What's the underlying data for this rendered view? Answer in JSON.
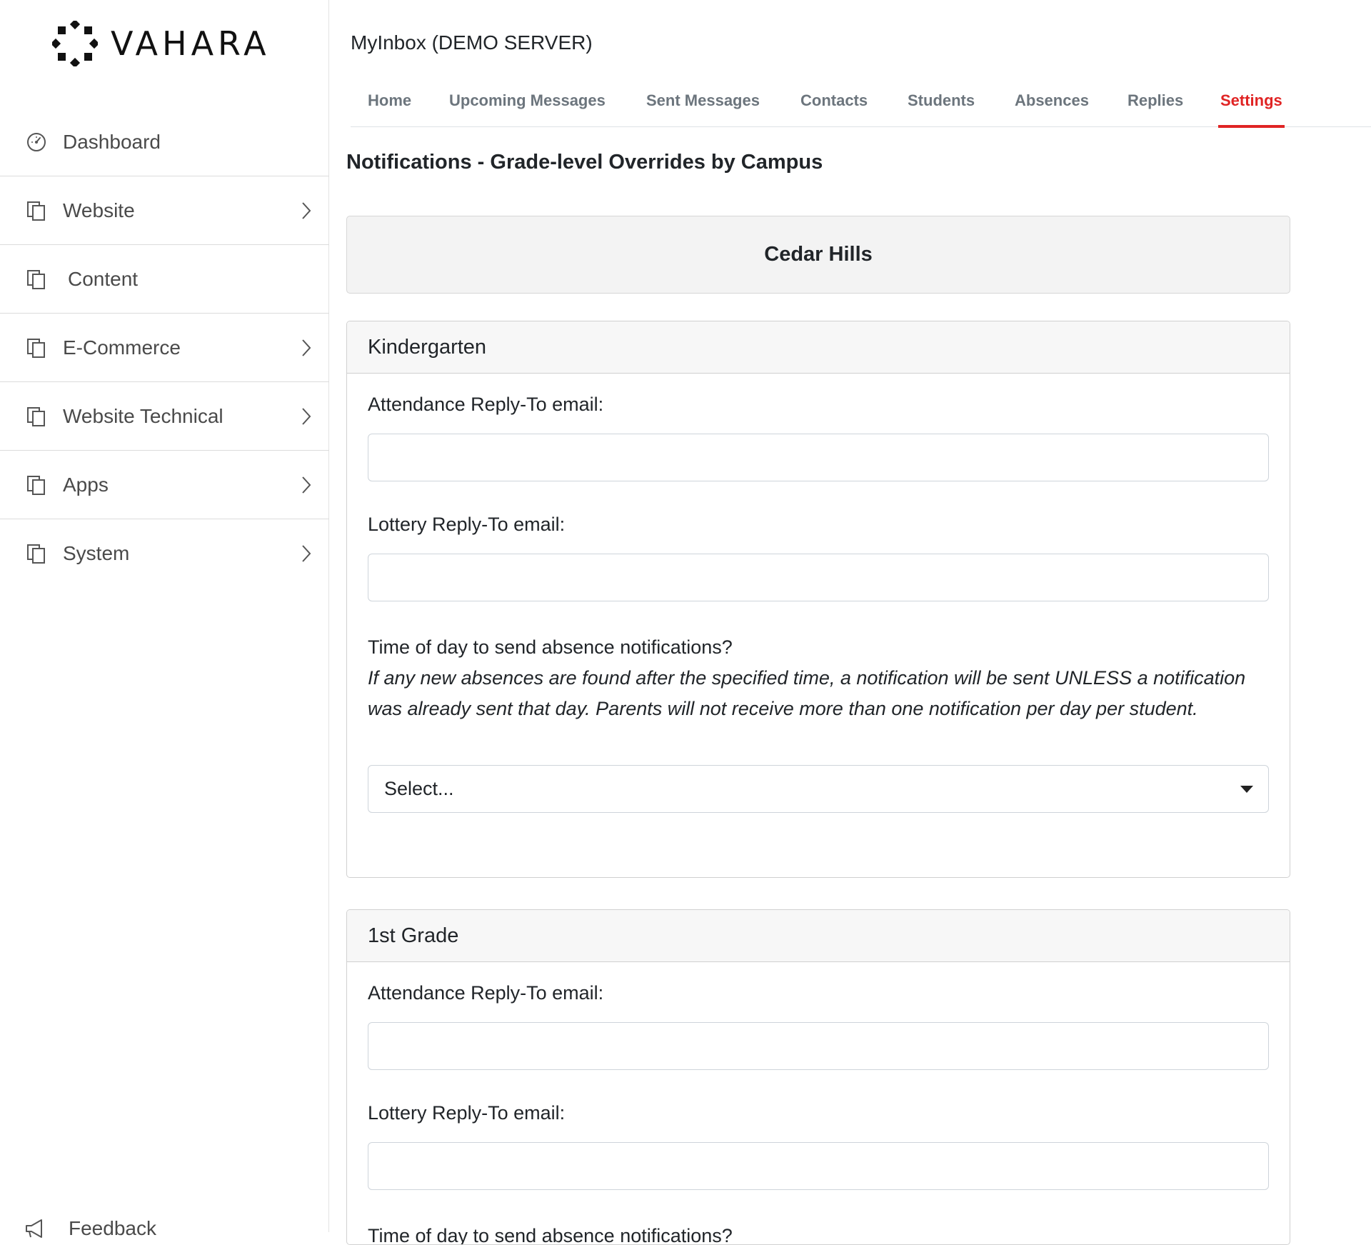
{
  "brand": {
    "name": "VAHARA"
  },
  "sidebar": {
    "items": [
      {
        "label": "Dashboard",
        "icon": "dashboard-gauge-icon",
        "has_chevron": false
      },
      {
        "label": "Website",
        "icon": "copy-pages-icon",
        "has_chevron": true
      },
      {
        "label": "Content",
        "icon": "copy-pages-icon",
        "has_chevron": false
      },
      {
        "label": "E-Commerce",
        "icon": "copy-pages-icon",
        "has_chevron": true
      },
      {
        "label": "Website Technical",
        "icon": "copy-pages-icon",
        "has_chevron": true
      },
      {
        "label": "Apps",
        "icon": "copy-pages-icon",
        "has_chevron": true
      },
      {
        "label": "System",
        "icon": "copy-pages-icon",
        "has_chevron": true
      }
    ],
    "feedback_label": "Feedback"
  },
  "app": {
    "title": "MyInbox (DEMO SERVER)"
  },
  "tabs": [
    {
      "label": "Home",
      "active": false
    },
    {
      "label": "Upcoming Messages",
      "active": false
    },
    {
      "label": "Sent Messages",
      "active": false
    },
    {
      "label": "Contacts",
      "active": false
    },
    {
      "label": "Students",
      "active": false
    },
    {
      "label": "Absences",
      "active": false
    },
    {
      "label": "Replies",
      "active": false
    },
    {
      "label": "Settings",
      "active": true
    }
  ],
  "page": {
    "title": "Notifications - Grade-level Overrides by Campus"
  },
  "campus": {
    "name": "Cedar Hills"
  },
  "grades": [
    {
      "name": "Kindergarten",
      "attendance_label": "Attendance Reply-To email:",
      "attendance_value": "",
      "lottery_label": "Lottery Reply-To email:",
      "lottery_value": "",
      "time_label": "Time of day to send absence notifications?",
      "time_note": "If any new absences are found after the specified time, a notification will be sent UNLESS a notification was already sent that day. Parents will not receive more than one notification per day per student.",
      "time_select": "Select..."
    },
    {
      "name": "1st Grade",
      "attendance_label": "Attendance Reply-To email:",
      "attendance_value": "",
      "lottery_label": "Lottery Reply-To email:",
      "lottery_value": "",
      "time_label": "Time of day to send absence notifications?"
    }
  ],
  "colors": {
    "accent": "#e02424",
    "text": "#212529",
    "muted_tab": "#6c757d"
  }
}
